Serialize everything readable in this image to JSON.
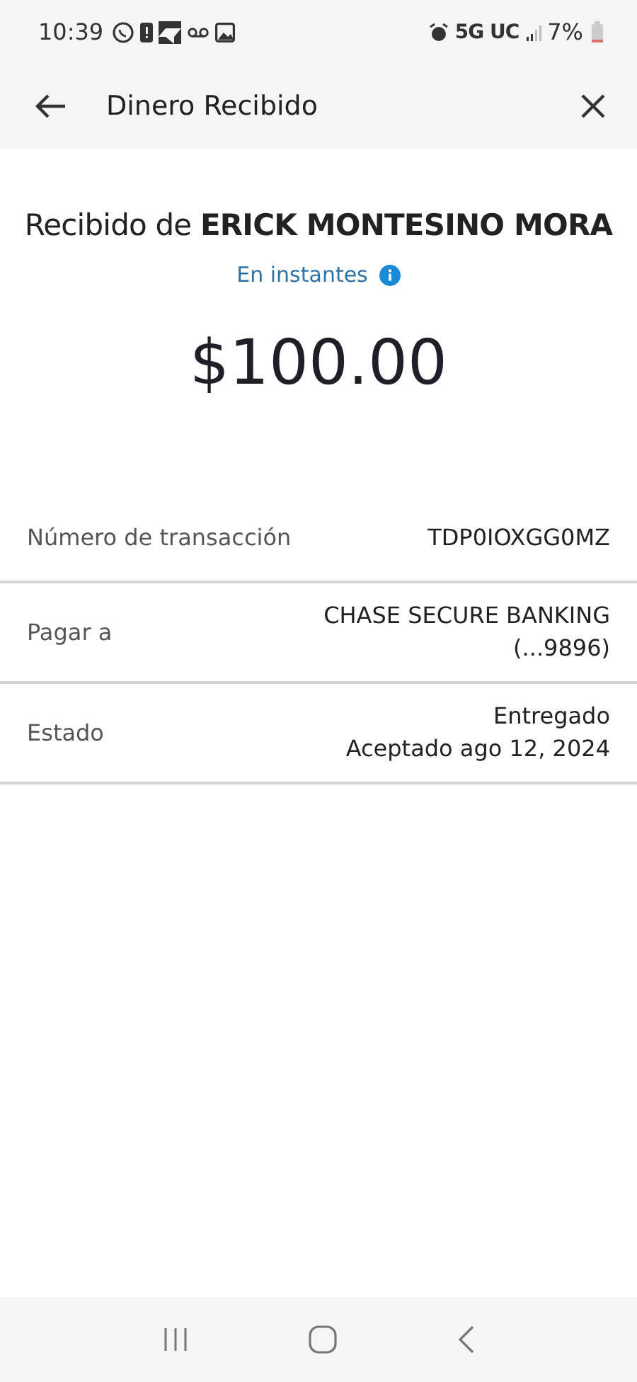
{
  "status_bar": {
    "time": "10:39",
    "network": "5G UC",
    "battery": "7%"
  },
  "header": {
    "title": "Dinero Recibido"
  },
  "summary": {
    "title": "Recibido de **ERICK MONTESINO MORA**",
    "speed": "En instantes",
    "amount": "$100.00"
  },
  "details": [
    {
      "label": "Número de transacción",
      "values": [
        "TDP0IOXGG0MZ"
      ]
    },
    {
      "label": "Pagar a",
      "values": [
        "CHASE SECURE BANKING",
        "(...9896)"
      ]
    },
    {
      "label": "Estado",
      "values": [
        "Entregado",
        "Aceptado ago 12, 2024"
      ]
    }
  ]
}
